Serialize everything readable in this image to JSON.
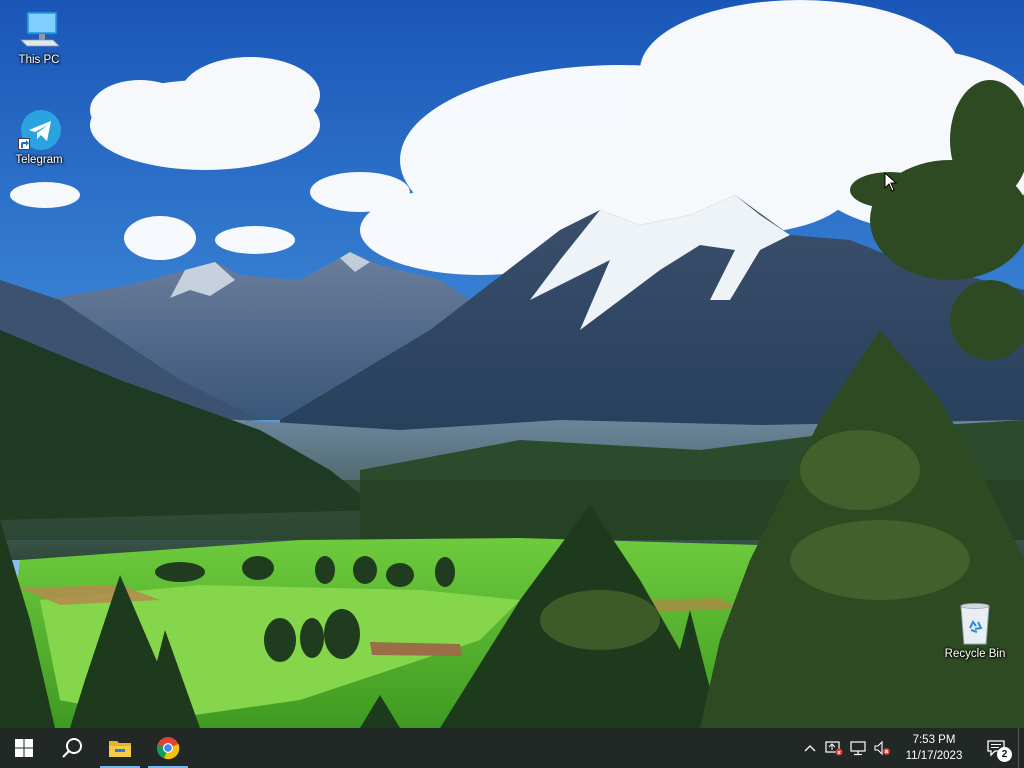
{
  "desktop": {
    "icons": [
      {
        "label": "This PC",
        "icon": "this-pc-icon"
      },
      {
        "label": "Telegram",
        "icon": "telegram-icon"
      },
      {
        "label": "Recycle Bin",
        "icon": "recycle-bin-icon"
      }
    ]
  },
  "taskbar": {
    "start_icon": "windows-logo-icon",
    "search_icon": "search-icon",
    "pinned": [
      {
        "icon": "file-explorer-icon",
        "active": true
      },
      {
        "icon": "chrome-icon",
        "active": true
      }
    ]
  },
  "tray": {
    "icons": [
      "chevron-up-icon",
      "defender-warning-icon",
      "network-icon",
      "volume-muted-icon"
    ],
    "time": "7:53 PM",
    "date": "11/17/2023",
    "notification_count": "2"
  },
  "colors": {
    "accent": "#76b9ed",
    "taskbar": "#10140e",
    "telegram": "#2aa3df",
    "sky": "#1d63c4"
  }
}
